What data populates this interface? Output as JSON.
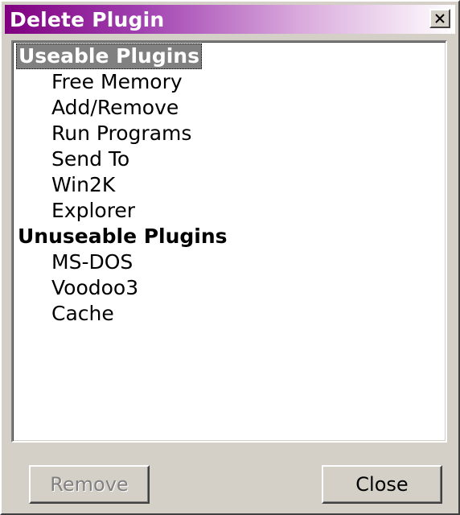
{
  "window": {
    "title": "Delete Plugin",
    "close_icon": "close-x-icon"
  },
  "tree": {
    "groups": [
      {
        "label": "Useable Plugins",
        "selected": true,
        "items": [
          "Free Memory",
          "Add/Remove",
          "Run Programs",
          "Send To",
          "Win2K",
          "Explorer"
        ]
      },
      {
        "label": "Unuseable Plugins",
        "selected": false,
        "items": [
          "MS-DOS",
          "Voodoo3",
          "Cache"
        ]
      }
    ]
  },
  "buttons": {
    "remove_label": "Remove",
    "remove_enabled": false,
    "close_label": "Close",
    "close_enabled": true
  },
  "colors": {
    "title_gradient_start": "#800080",
    "title_gradient_end": "#ffffff",
    "selection_bg": "#808080",
    "face": "#d4d0c8"
  }
}
